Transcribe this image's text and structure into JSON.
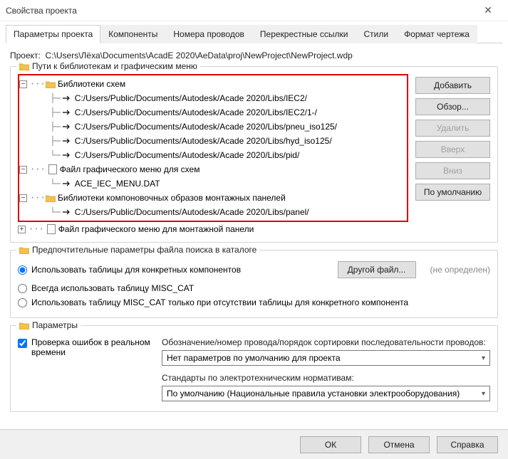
{
  "window": {
    "title": "Свойства проекта"
  },
  "tabs": [
    "Параметры проекта",
    "Компоненты",
    "Номера проводов",
    "Перекрестные ссылки",
    "Стили",
    "Формат чертежа"
  ],
  "project": {
    "label": "Проект:",
    "path": "C:\\Users\\Лёха\\Documents\\AcadE 2020\\AeData\\proj\\NewProject\\NewProject.wdp"
  },
  "libs": {
    "section_title": "Пути к библиотекам и графическим меню",
    "schem_title": "Библиотеки схем",
    "schem_paths": [
      "C:/Users/Public/Documents/Autodesk/Acade 2020/Libs/IEC2/",
      "C:/Users/Public/Documents/Autodesk/Acade 2020/Libs/IEC2/1-/",
      "C:/Users/Public/Documents/Autodesk/Acade 2020/Libs/pneu_iso125/",
      "C:/Users/Public/Documents/Autodesk/Acade 2020/Libs/hyd_iso125/",
      "C:/Users/Public/Documents/Autodesk/Acade 2020/Libs/pid/"
    ],
    "menu_schem_title": "Файл графического меню для схем",
    "menu_schem_file": "ACE_IEC_MENU.DAT",
    "panel_title": "Библиотеки компоновочных образов монтажных панелей",
    "panel_paths": [
      "C:/Users/Public/Documents/Autodesk/Acade 2020/Libs/panel/"
    ],
    "menu_panel_title": "Файл графического меню для монтажной панели"
  },
  "buttons": {
    "add": "Добавить",
    "browse": "Обзор...",
    "delete": "Удалить",
    "up": "Вверх",
    "down": "Вниз",
    "default": "По умолчанию"
  },
  "catalog": {
    "section_title": "Предпочтительные параметры файла поиска в каталоге",
    "opt1": "Использовать таблицы для конкретных компонентов",
    "opt2": "Всегда использовать таблицу MISC_CAT",
    "opt3": "Использовать таблицу MISC_CAT только при отсутствии таблицы для конкретного компонента",
    "other_file": "Другой файл...",
    "not_defined": "(не определен)"
  },
  "params": {
    "section_title": "Параметры",
    "check_label": "Проверка ошибок в реальном времени",
    "desig_label": "Обозначение/номер провода/порядок сортировки последовательности проводов:",
    "desig_combo": "Нет параметров по умолчанию для проекта",
    "std_label": "Стандарты по электротехническим нормативам:",
    "std_combo": "По умолчанию (Национальные правила установки электрооборудования)"
  },
  "footer": {
    "ok": "ОК",
    "cancel": "Отмена",
    "help": "Справка"
  }
}
